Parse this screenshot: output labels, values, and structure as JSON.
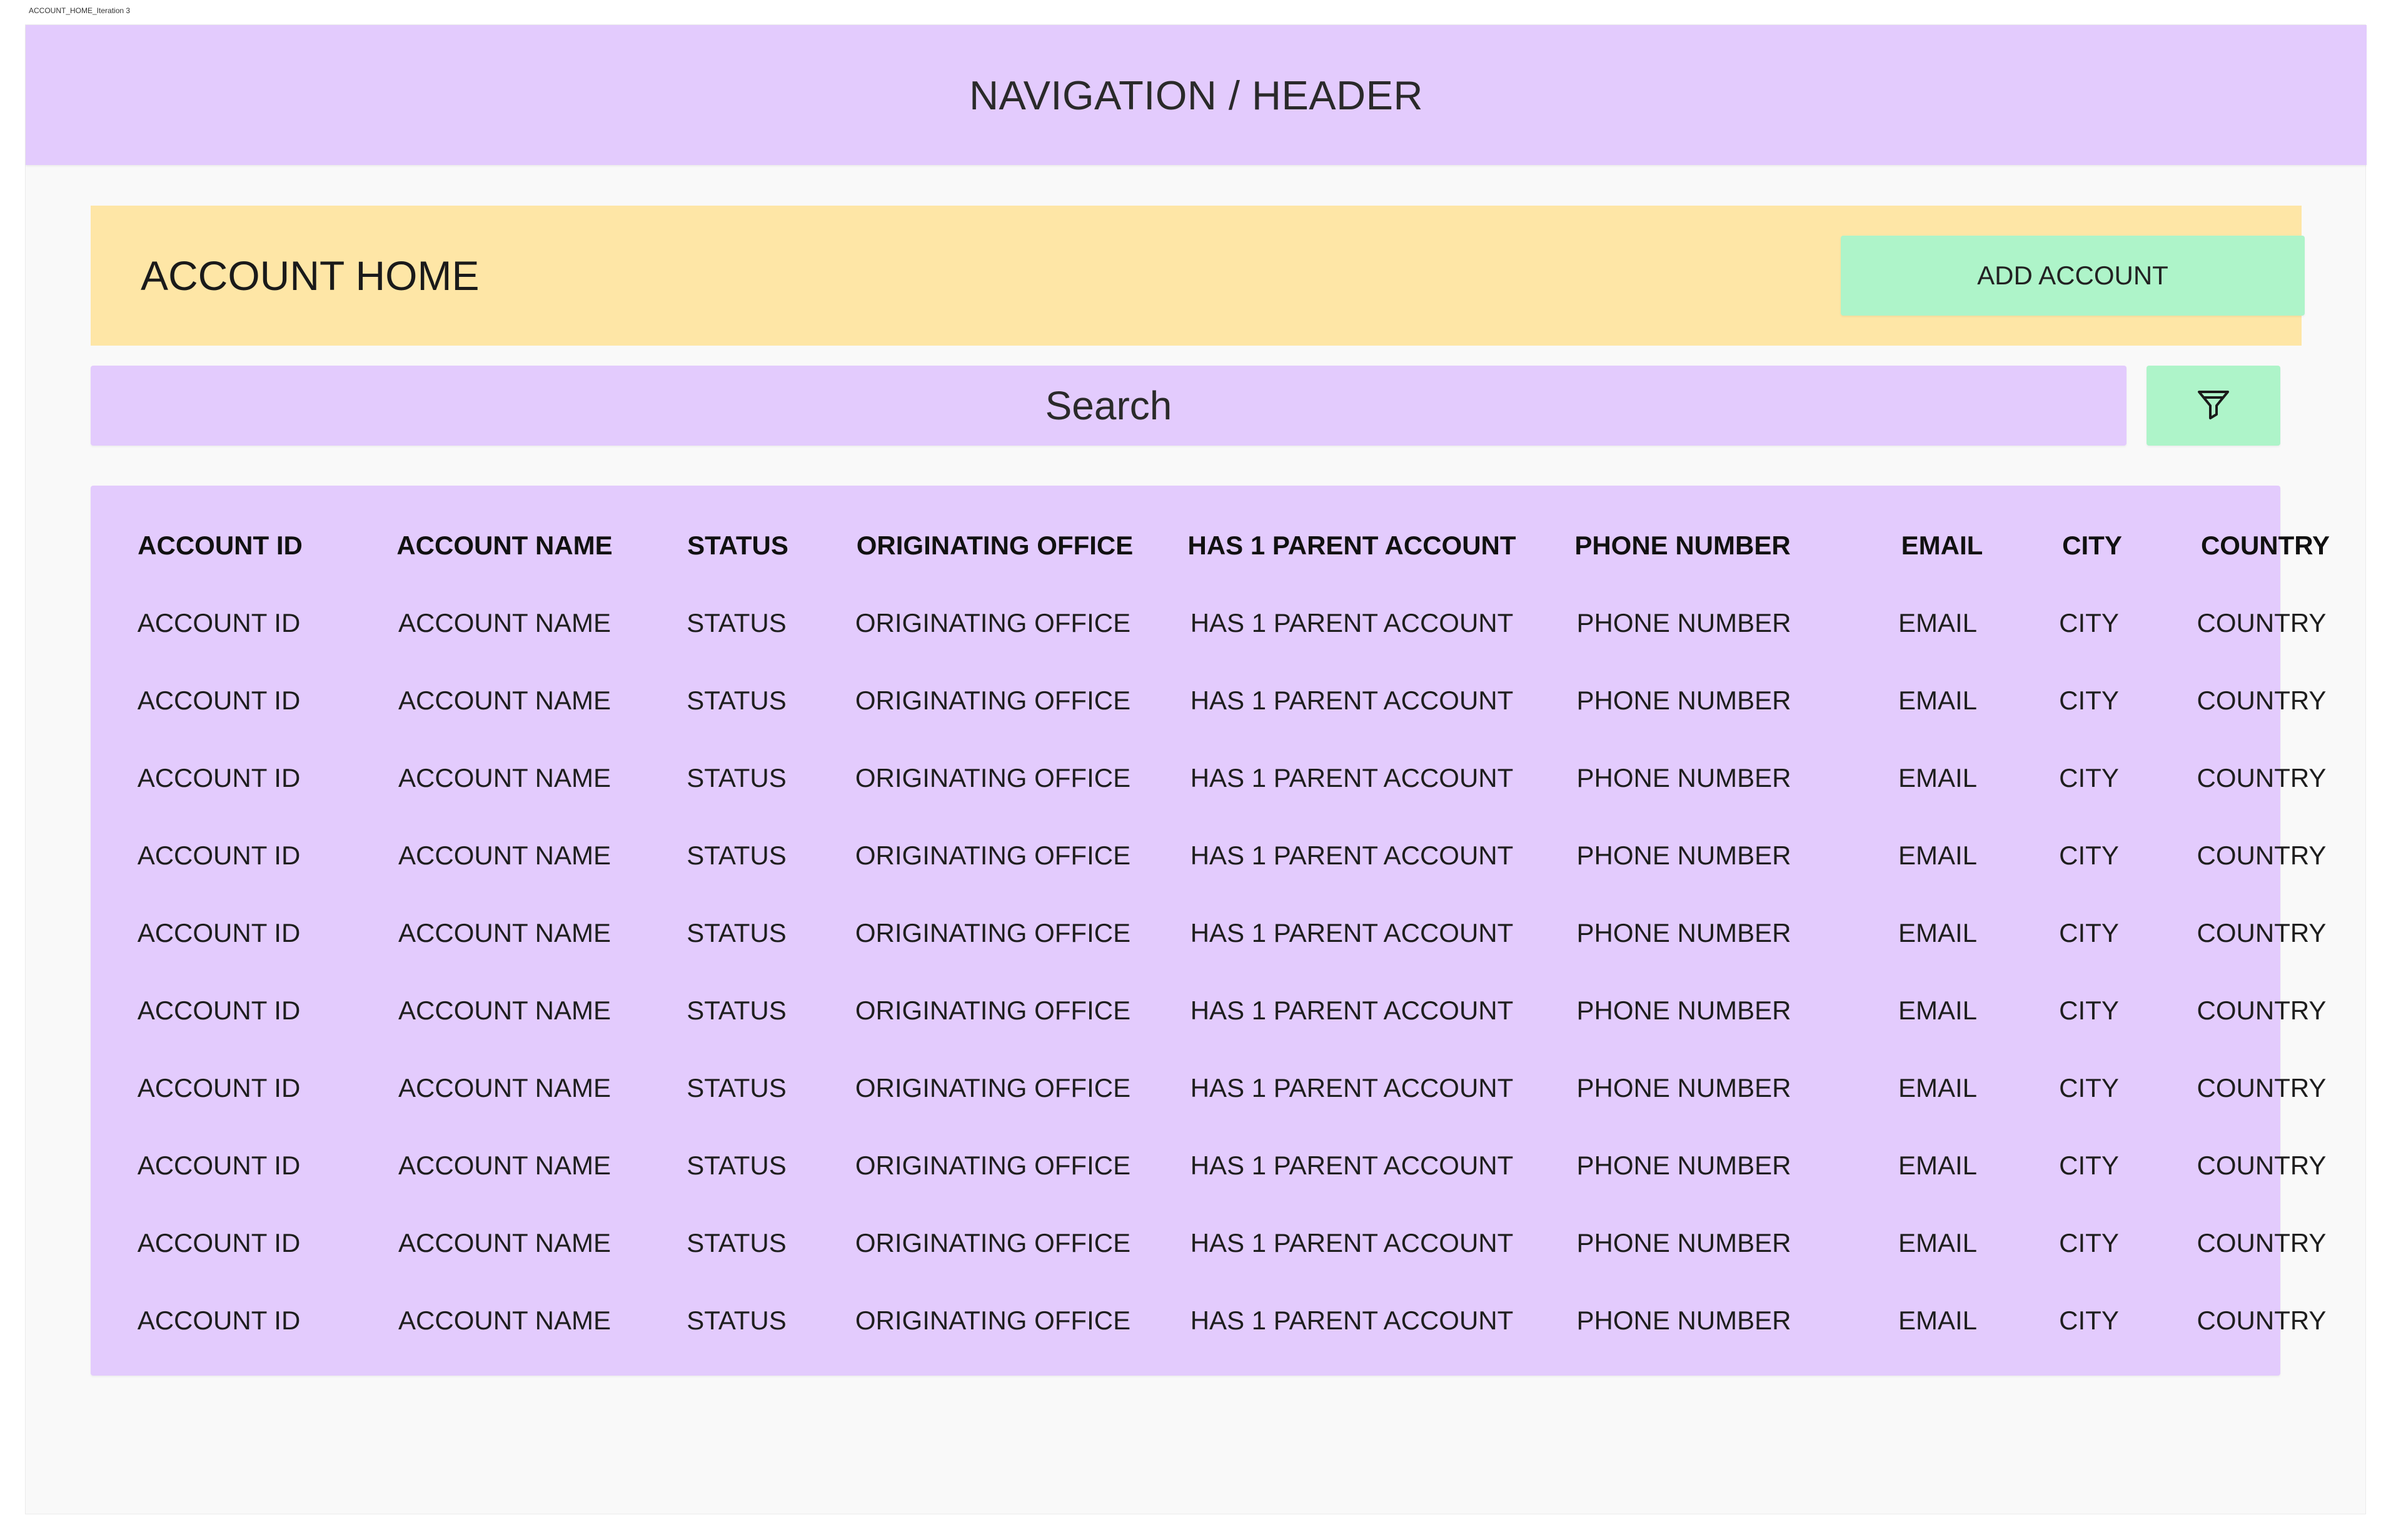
{
  "frame": {
    "label": "ACCOUNT_HOME_Iteration 3"
  },
  "nav": {
    "title": "NAVIGATION / HEADER"
  },
  "account_bar": {
    "title": "ACCOUNT HOME",
    "add_button_label": "ADD ACCOUNT"
  },
  "search": {
    "label": "Search"
  },
  "filter": {
    "icon": "filter-funnel-icon"
  },
  "table": {
    "columns": [
      "ACCOUNT ID",
      "ACCOUNT NAME",
      "STATUS",
      "ORIGINATING OFFICE",
      "HAS 1 PARENT ACCOUNT",
      "PHONE NUMBER",
      "EMAIL",
      "CITY",
      "COUNTRY"
    ],
    "rows": [
      [
        "ACCOUNT ID",
        "ACCOUNT NAME",
        "STATUS",
        "ORIGINATING OFFICE",
        "HAS 1 PARENT ACCOUNT",
        "PHONE NUMBER",
        "EMAIL",
        "CITY",
        "COUNTRY"
      ],
      [
        "ACCOUNT ID",
        "ACCOUNT NAME",
        "STATUS",
        "ORIGINATING OFFICE",
        "HAS 1 PARENT ACCOUNT",
        "PHONE NUMBER",
        "EMAIL",
        "CITY",
        "COUNTRY"
      ],
      [
        "ACCOUNT ID",
        "ACCOUNT NAME",
        "STATUS",
        "ORIGINATING OFFICE",
        "HAS 1 PARENT ACCOUNT",
        "PHONE NUMBER",
        "EMAIL",
        "CITY",
        "COUNTRY"
      ],
      [
        "ACCOUNT ID",
        "ACCOUNT NAME",
        "STATUS",
        "ORIGINATING OFFICE",
        "HAS 1 PARENT ACCOUNT",
        "PHONE NUMBER",
        "EMAIL",
        "CITY",
        "COUNTRY"
      ],
      [
        "ACCOUNT ID",
        "ACCOUNT NAME",
        "STATUS",
        "ORIGINATING OFFICE",
        "HAS 1 PARENT ACCOUNT",
        "PHONE NUMBER",
        "EMAIL",
        "CITY",
        "COUNTRY"
      ],
      [
        "ACCOUNT ID",
        "ACCOUNT NAME",
        "STATUS",
        "ORIGINATING OFFICE",
        "HAS 1 PARENT ACCOUNT",
        "PHONE NUMBER",
        "EMAIL",
        "CITY",
        "COUNTRY"
      ],
      [
        "ACCOUNT ID",
        "ACCOUNT NAME",
        "STATUS",
        "ORIGINATING OFFICE",
        "HAS 1 PARENT ACCOUNT",
        "PHONE NUMBER",
        "EMAIL",
        "CITY",
        "COUNTRY"
      ],
      [
        "ACCOUNT ID",
        "ACCOUNT NAME",
        "STATUS",
        "ORIGINATING OFFICE",
        "HAS 1 PARENT ACCOUNT",
        "PHONE NUMBER",
        "EMAIL",
        "CITY",
        "COUNTRY"
      ],
      [
        "ACCOUNT ID",
        "ACCOUNT NAME",
        "STATUS",
        "ORIGINATING OFFICE",
        "HAS 1 PARENT ACCOUNT",
        "PHONE NUMBER",
        "EMAIL",
        "CITY",
        "COUNTRY"
      ],
      [
        "ACCOUNT ID",
        "ACCOUNT NAME",
        "STATUS",
        "ORIGINATING OFFICE",
        "HAS 1 PARENT ACCOUNT",
        "PHONE NUMBER",
        "EMAIL",
        "CITY",
        "COUNTRY"
      ]
    ]
  },
  "colors": {
    "frame_background": "#f9f9f9",
    "lavender_panel": "#e3cbfd",
    "yellow_panel": "#fee6a6",
    "green_button": "#aef4c9",
    "text": "#1e1e1e"
  }
}
